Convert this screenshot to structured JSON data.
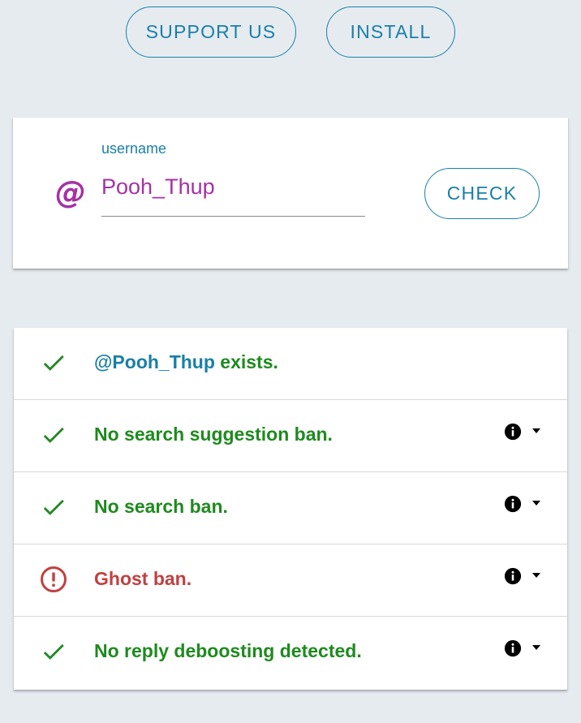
{
  "top_buttons": {
    "support_label": "SUPPORT US",
    "install_label": "INSTALL"
  },
  "search": {
    "at_symbol": "@",
    "field_label": "username",
    "value": "Pooh_Thup",
    "check_label": "CHECK"
  },
  "results": {
    "exists": {
      "mention": "@Pooh_Thup",
      "text": " exists.",
      "status": "ok",
      "icon": "check-icon"
    },
    "items": [
      {
        "text": "No search suggestion ban.",
        "status": "ok",
        "icon": "check-icon"
      },
      {
        "text": "No search ban.",
        "status": "ok",
        "icon": "check-icon"
      },
      {
        "text": "Ghost ban.",
        "status": "ban",
        "icon": "alert-circle-icon"
      },
      {
        "text": "No reply deboosting detected.",
        "status": "ok",
        "icon": "check-icon"
      }
    ]
  },
  "colors": {
    "accent": "#1a7fa8",
    "purple": "#a531a5",
    "ok_green": "#1f8a1f",
    "ban_red": "#c24040",
    "background": "#e6ebf0"
  }
}
